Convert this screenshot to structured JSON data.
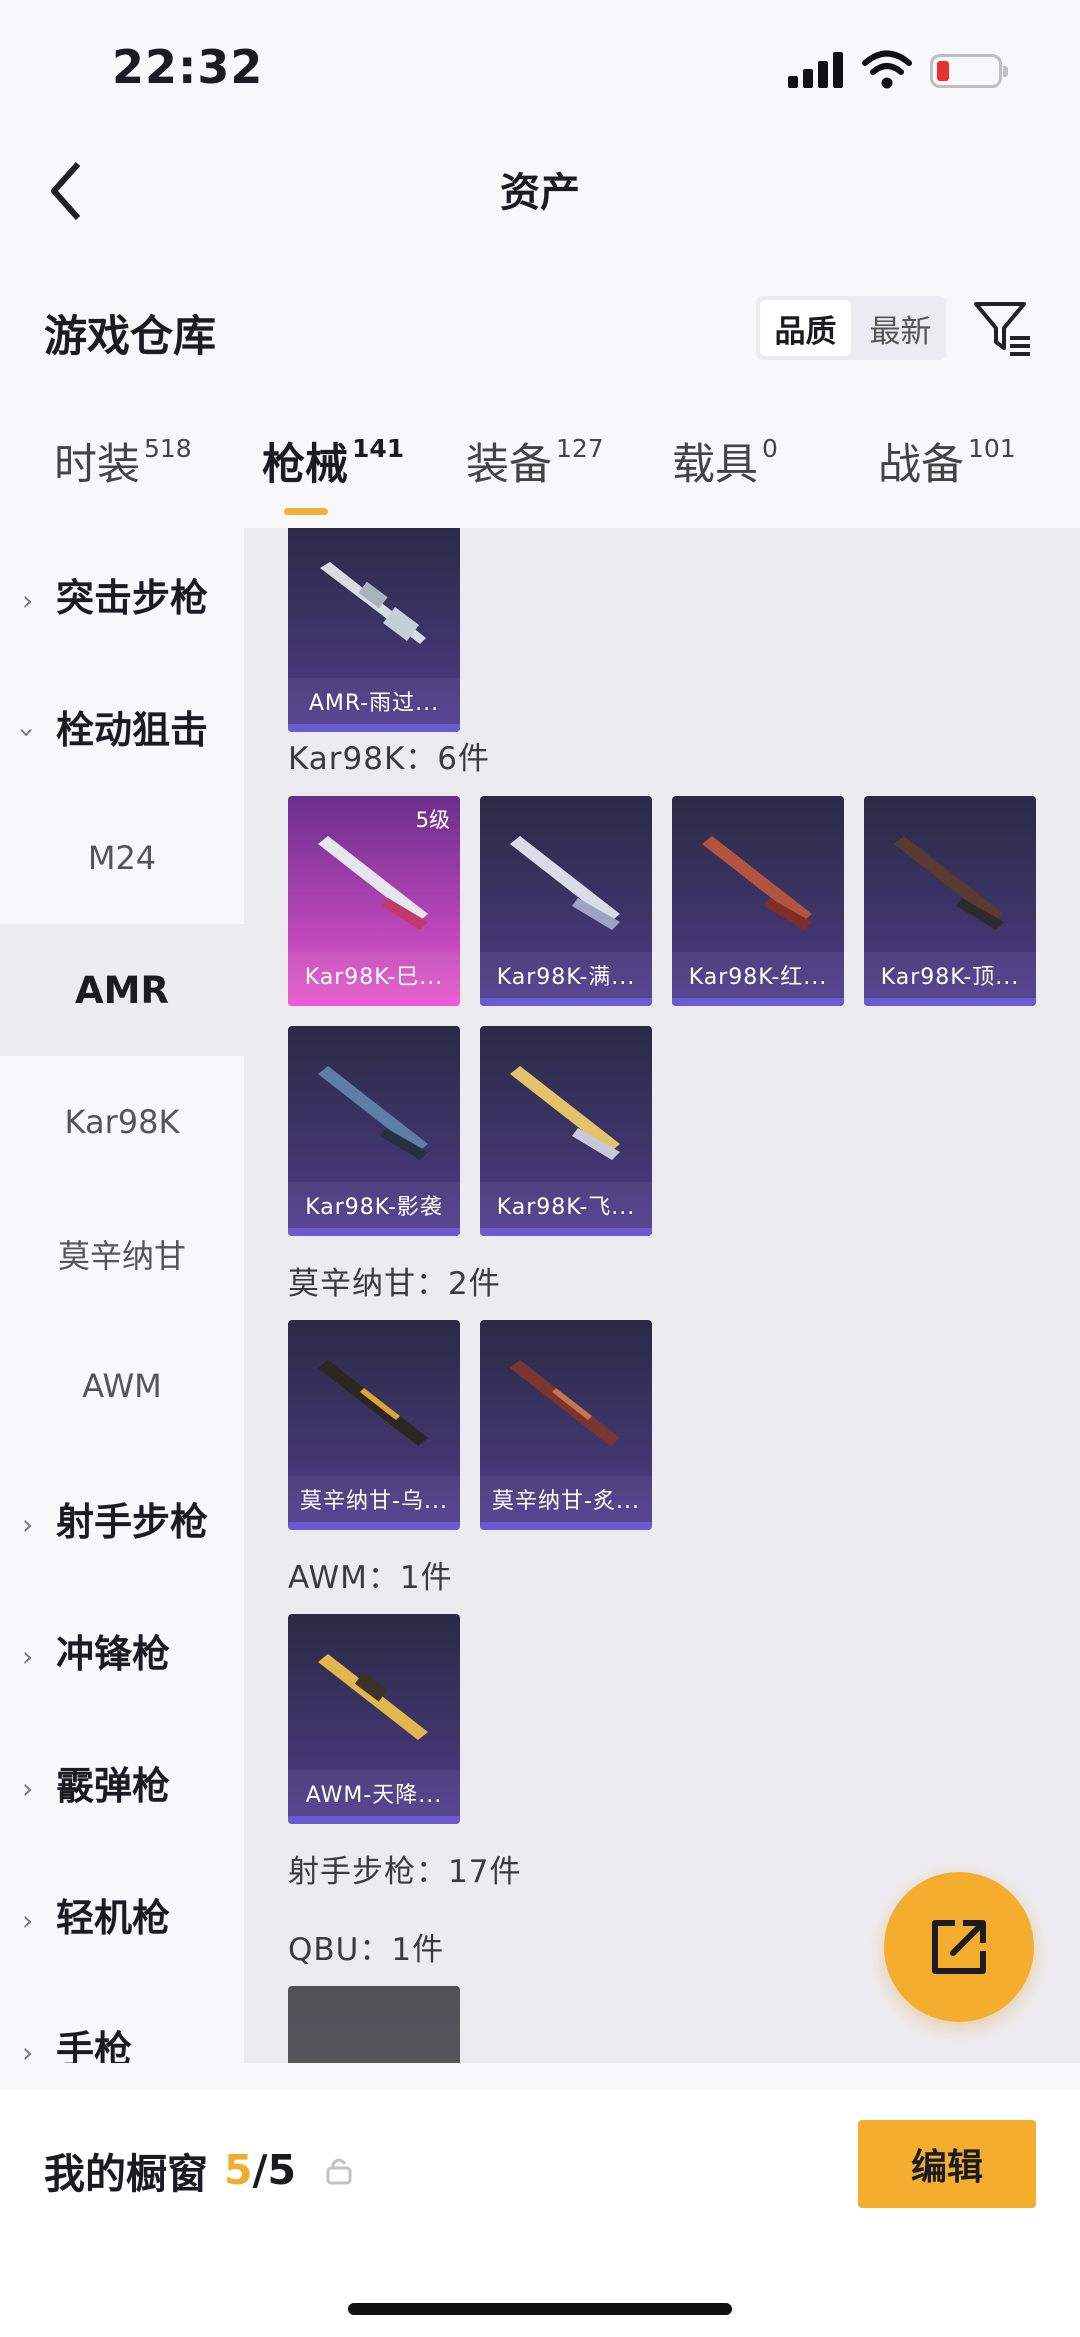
{
  "status": {
    "time": "22:32"
  },
  "nav": {
    "title": "资产"
  },
  "header": {
    "title": "游戏仓库",
    "sort_quality": "品质",
    "sort_latest": "最新"
  },
  "tabs": [
    {
      "label": "时装",
      "count": "518"
    },
    {
      "label": "枪械",
      "count": "141"
    },
    {
      "label": "装备",
      "count": "127"
    },
    {
      "label": "载具",
      "count": "0"
    },
    {
      "label": "战备",
      "count": "101"
    }
  ],
  "sidebar": [
    {
      "label": "突击步枪"
    },
    {
      "label": "栓动狙击"
    },
    {
      "label": "M24"
    },
    {
      "label": "AMR"
    },
    {
      "label": "Kar98K"
    },
    {
      "label": "莫辛纳甘"
    },
    {
      "label": "AWM"
    },
    {
      "label": "射手步枪"
    },
    {
      "label": "冲锋枪"
    },
    {
      "label": "霰弹枪"
    },
    {
      "label": "轻机枪"
    },
    {
      "label": "手枪"
    }
  ],
  "groups": [
    {
      "label": "Kar98K：6件"
    },
    {
      "label": "莫辛纳甘：2件"
    },
    {
      "label": "AWM：1件"
    },
    {
      "label": "射手步枪：17件"
    },
    {
      "label": "QBU：1件"
    }
  ],
  "items": [
    {
      "name": "AMR-雨过..."
    },
    {
      "name": "Kar98K-巳...",
      "level": "5级"
    },
    {
      "name": "Kar98K-满..."
    },
    {
      "name": "Kar98K-红..."
    },
    {
      "name": "Kar98K-顶..."
    },
    {
      "name": "Kar98K-影袭"
    },
    {
      "name": "Kar98K-飞..."
    },
    {
      "name": "莫辛纳甘-乌..."
    },
    {
      "name": "莫辛纳甘-炙..."
    },
    {
      "name": "AWM-天降..."
    }
  ],
  "bottom": {
    "label": "我的橱窗",
    "current": "5",
    "total": "/5",
    "edit": "编辑"
  },
  "colors": {
    "accent": "#f5ad2e",
    "item_purple": "#4e3c8e",
    "item_pink": "#e45bc8"
  }
}
